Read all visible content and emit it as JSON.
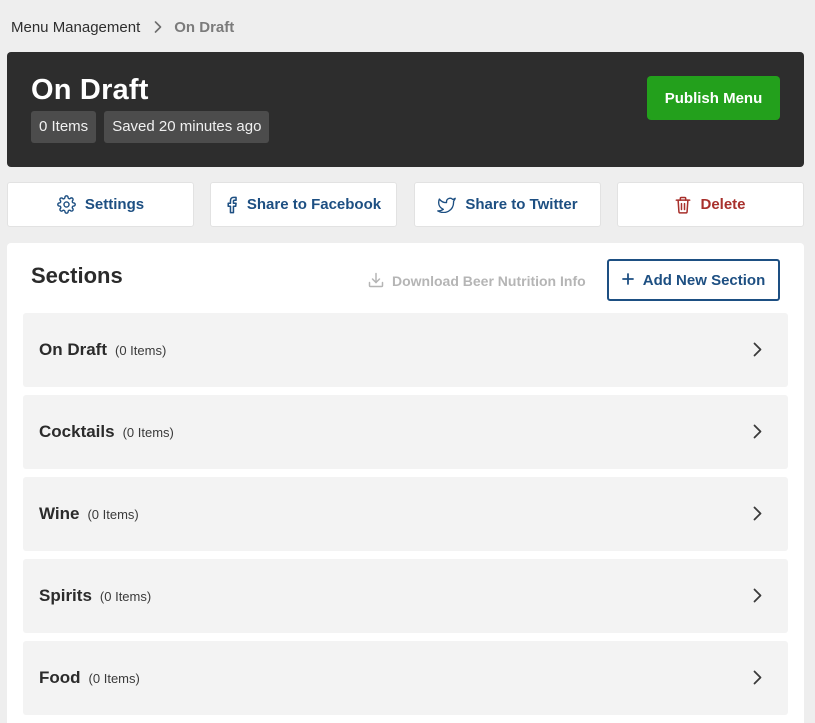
{
  "breadcrumb": {
    "root": "Menu Management",
    "current": "On Draft"
  },
  "header": {
    "title": "On Draft",
    "items_tag": "0 Items",
    "saved_tag": "Saved 20 minutes ago",
    "publish_label": "Publish Menu"
  },
  "actions": {
    "settings": "Settings",
    "facebook": "Share to Facebook",
    "twitter": "Share to Twitter",
    "delete": "Delete"
  },
  "sections": {
    "title": "Sections",
    "download_label": "Download Beer Nutrition Info",
    "add_label": "Add New Section",
    "items": [
      {
        "name": "On Draft",
        "count": "(0 Items)"
      },
      {
        "name": "Cocktails",
        "count": "(0 Items)"
      },
      {
        "name": "Wine",
        "count": "(0 Items)"
      },
      {
        "name": "Spirits",
        "count": "(0 Items)"
      },
      {
        "name": "Food",
        "count": "(0 Items)"
      }
    ]
  },
  "colors": {
    "header_bg": "#2d2d2d",
    "publish_green": "#23a01c",
    "link_blue": "#1d4f82",
    "danger_red": "#a8302c",
    "page_bg": "#eeeeee",
    "row_bg": "#f3f3f3"
  },
  "icons": {
    "breadcrumb_separator": "chevron-right-icon",
    "settings": "gear-icon",
    "facebook": "facebook-icon",
    "twitter": "twitter-icon",
    "delete": "trash-icon",
    "download": "download-icon",
    "add": "plus-icon",
    "row_arrow": "chevron-right-icon"
  }
}
